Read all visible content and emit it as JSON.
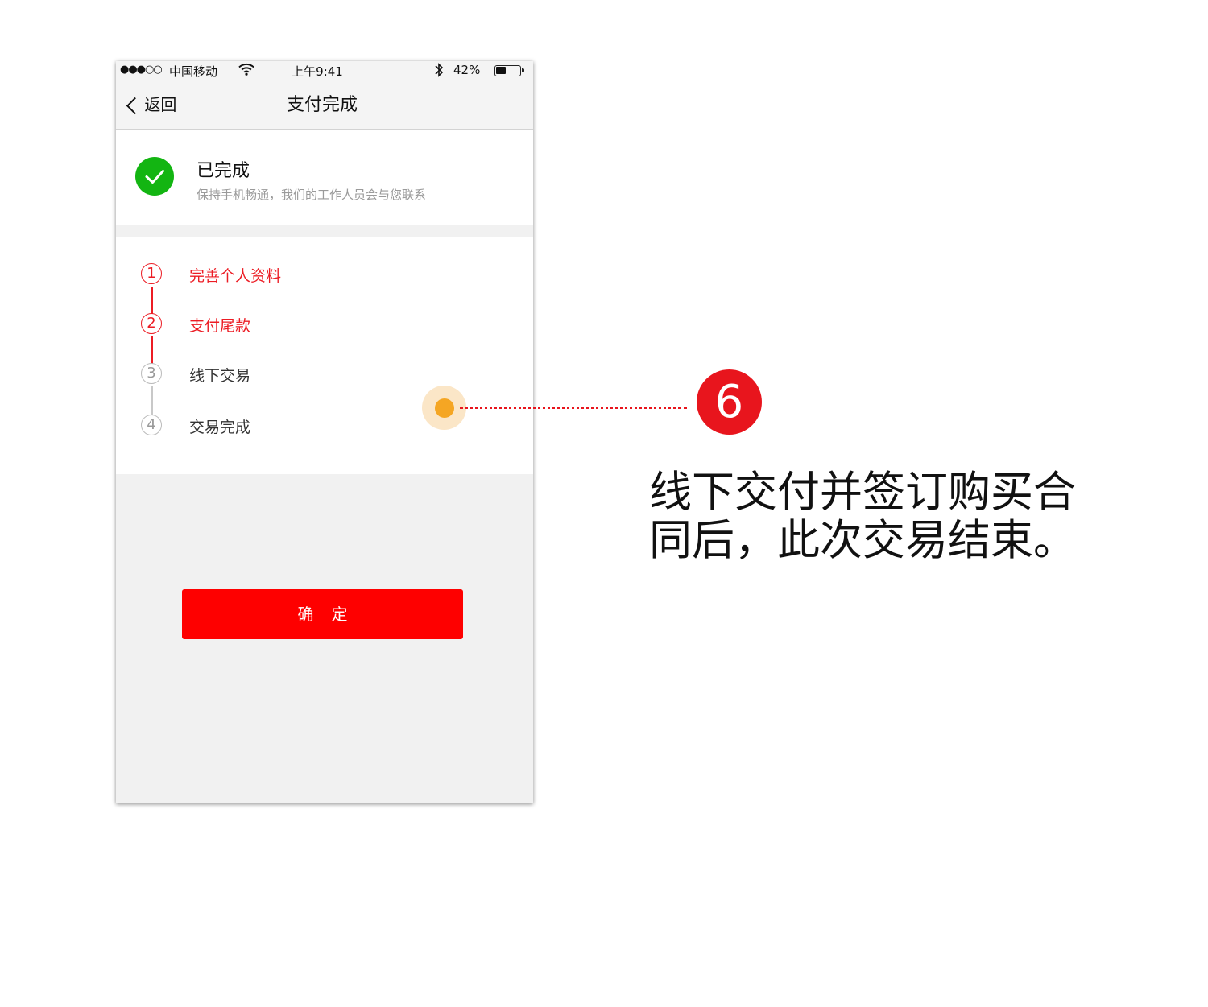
{
  "status_bar": {
    "signal": "●●●○○",
    "carrier": "中国移动",
    "wifi_icon": "wifi-icon",
    "time": "上午9:41",
    "bluetooth_icon": "bluetooth-icon",
    "battery_percent": "42%",
    "battery_level": 0.42
  },
  "nav": {
    "back_label": "返回",
    "title": "支付完成"
  },
  "completion": {
    "icon": "check-circle-icon",
    "title": "已完成",
    "subtitle": "保持手机畅通，我们的工作人员会与您联系"
  },
  "steps": [
    {
      "number": "1",
      "label": "完善个人资料",
      "state": "done"
    },
    {
      "number": "2",
      "label": "支付尾款",
      "state": "done"
    },
    {
      "number": "3",
      "label": "线下交易",
      "state": "pending"
    },
    {
      "number": "4",
      "label": "交易完成",
      "state": "pending"
    }
  ],
  "confirm_button": "确定",
  "annotation": {
    "badge": "6",
    "text": "线下交付并签订购买合同后，此次交易结束。"
  },
  "colors": {
    "accent_red": "#fe0000",
    "step_red": "#ec1c24",
    "success_green": "#13b512",
    "hotspot_orange": "#f5a623"
  }
}
